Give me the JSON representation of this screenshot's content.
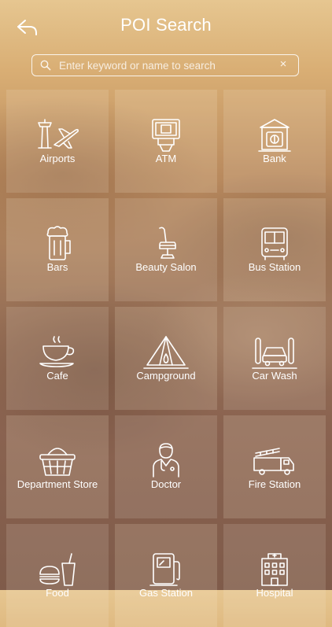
{
  "header": {
    "title": "POI Search",
    "back_icon": "back-arrow-icon"
  },
  "search": {
    "placeholder": "Enter keyword or name to search",
    "value": "",
    "search_icon": "magnifier-icon",
    "clear_label": "×"
  },
  "categories": [
    {
      "label": "Airports",
      "icon": "airport-icon"
    },
    {
      "label": "ATM",
      "icon": "atm-icon"
    },
    {
      "label": "Bank",
      "icon": "bank-icon"
    },
    {
      "label": "Bars",
      "icon": "beer-mug-icon"
    },
    {
      "label": "Beauty Salon",
      "icon": "salon-chair-icon"
    },
    {
      "label": "Bus Station",
      "icon": "bus-icon"
    },
    {
      "label": "Cafe",
      "icon": "coffee-cup-icon"
    },
    {
      "label": "Campground",
      "icon": "tent-icon"
    },
    {
      "label": "Car Wash",
      "icon": "car-wash-icon"
    },
    {
      "label": "Department Store",
      "icon": "basket-icon"
    },
    {
      "label": "Doctor",
      "icon": "doctor-icon"
    },
    {
      "label": "Fire Station",
      "icon": "fire-truck-icon"
    },
    {
      "label": "Food",
      "icon": "burger-drink-icon"
    },
    {
      "label": "Gas Station",
      "icon": "fuel-pump-icon"
    },
    {
      "label": "Hospital",
      "icon": "hospital-building-icon"
    }
  ],
  "colors": {
    "text": "#ffffff",
    "tile_bg": "rgba(255,240,220,0.16)"
  }
}
